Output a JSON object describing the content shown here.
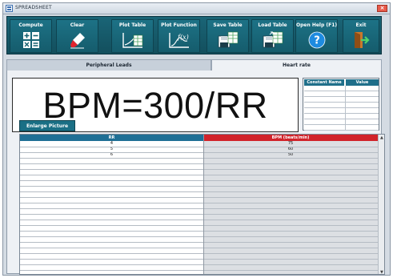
{
  "window": {
    "title": "SPREADSHEET",
    "close": "×"
  },
  "toolbar": {
    "buttons": [
      {
        "label": "Compute",
        "icon": "calculator-icon"
      },
      {
        "label": "Clear",
        "icon": "eraser-icon"
      },
      {
        "label": "Plot Table",
        "icon": "plot-table-icon"
      },
      {
        "label": "Plot Function",
        "icon": "plot-function-icon",
        "icon_text": "f(x)"
      },
      {
        "label": "Save Table",
        "icon": "save-table-icon"
      },
      {
        "label": "Load Table",
        "icon": "load-table-icon"
      },
      {
        "label": "Open Help (F1)",
        "icon": "help-icon",
        "icon_text": "?"
      },
      {
        "label": "Exit",
        "icon": "exit-icon"
      }
    ]
  },
  "tabs": [
    {
      "label": "Peripheral Leads",
      "active": false
    },
    {
      "label": "Heart rate",
      "active": true
    }
  ],
  "formula": {
    "text": "BPM=300/RR",
    "enlarge_label": "Enlarge Picture"
  },
  "constants_table": {
    "headers": [
      "Constant Name",
      "Value"
    ],
    "rows": 8
  },
  "data_table": {
    "headers": [
      "RR",
      "BPM (beats/min)"
    ],
    "rows": [
      [
        "4",
        "75"
      ],
      [
        "5",
        "60"
      ],
      [
        "6",
        "50"
      ]
    ]
  },
  "colors": {
    "toolbar": "#1a6577",
    "rr_header": "#1f6f95",
    "bpm_header": "#d1232a",
    "help_icon": "#1e8be0"
  }
}
